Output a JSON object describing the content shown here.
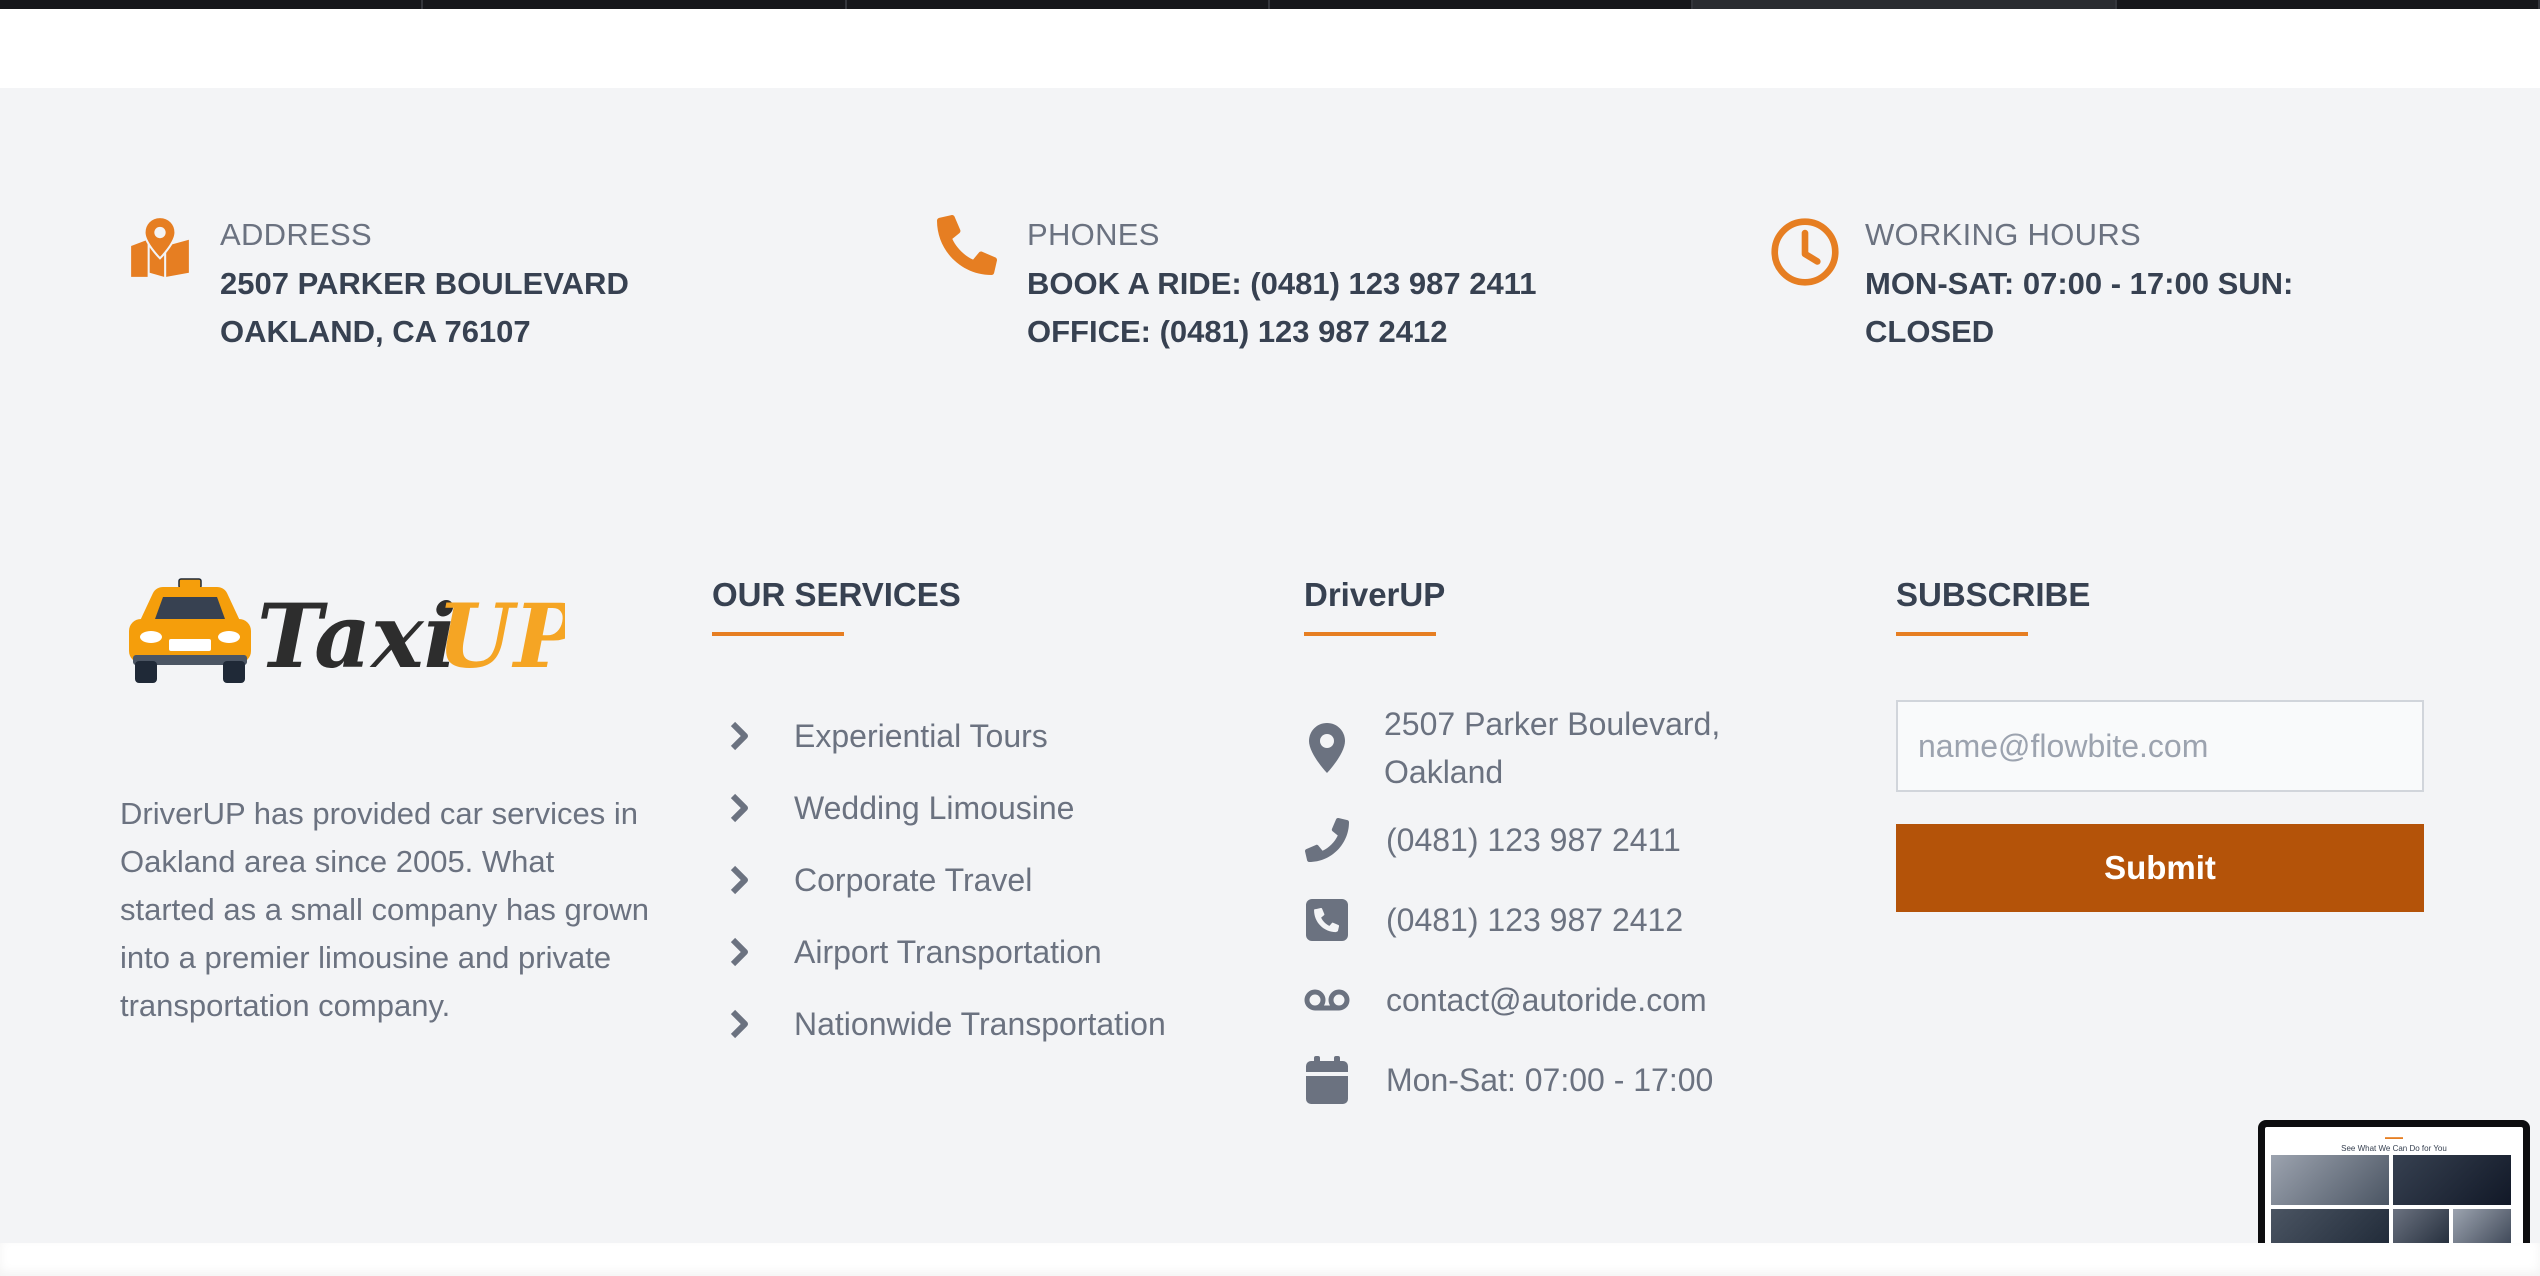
{
  "contact_bar": {
    "address": {
      "icon": "map-marker-icon",
      "label": "ADDRESS",
      "line1": "2507 PARKER BOULEVARD",
      "line2": "OAKLAND, CA 76107"
    },
    "phones": {
      "icon": "phone-icon",
      "label": "PHONES",
      "line1": "BOOK A RIDE: (0481) 123 987 2411",
      "line2": "OFFICE: (0481) 123 987 2412"
    },
    "hours": {
      "icon": "clock-icon",
      "label": "WORKING HOURS",
      "line1": "MON-SAT: 07:00 - 17:00 SUN:",
      "line2": "CLOSED"
    }
  },
  "brand": {
    "logo_text_dark": "Taxi",
    "logo_text_accent": "UP",
    "about": "DriverUP has provided car services in Oakland area since 2005. What started as a small company has grown into a premier limousine and private transportation company."
  },
  "services": {
    "title": "OUR SERVICES",
    "items": [
      {
        "label": "Experiential Tours"
      },
      {
        "label": "Wedding Limousine"
      },
      {
        "label": "Corporate Travel"
      },
      {
        "label": "Airport Transportation"
      },
      {
        "label": "Nationwide Transportation"
      }
    ]
  },
  "company": {
    "title": "DriverUP",
    "address_line1": "2507 Parker Boulevard,",
    "address_line2": "Oakland",
    "phone1": "(0481) 123 987 2411",
    "phone2": "(0481) 123 987 2412",
    "email": "contact@autoride.com",
    "hours": "Mon-Sat: 07:00 - 17:00"
  },
  "subscribe": {
    "title": "SUBSCRIBE",
    "placeholder": "name@flowbite.com",
    "button": "Submit"
  },
  "thumbnail": {
    "title": "See What We Can Do for You"
  },
  "colors": {
    "accent": "#e67e22",
    "button": "#b45309",
    "background": "#f3f4f6",
    "muted_icon": "#6b7280"
  }
}
